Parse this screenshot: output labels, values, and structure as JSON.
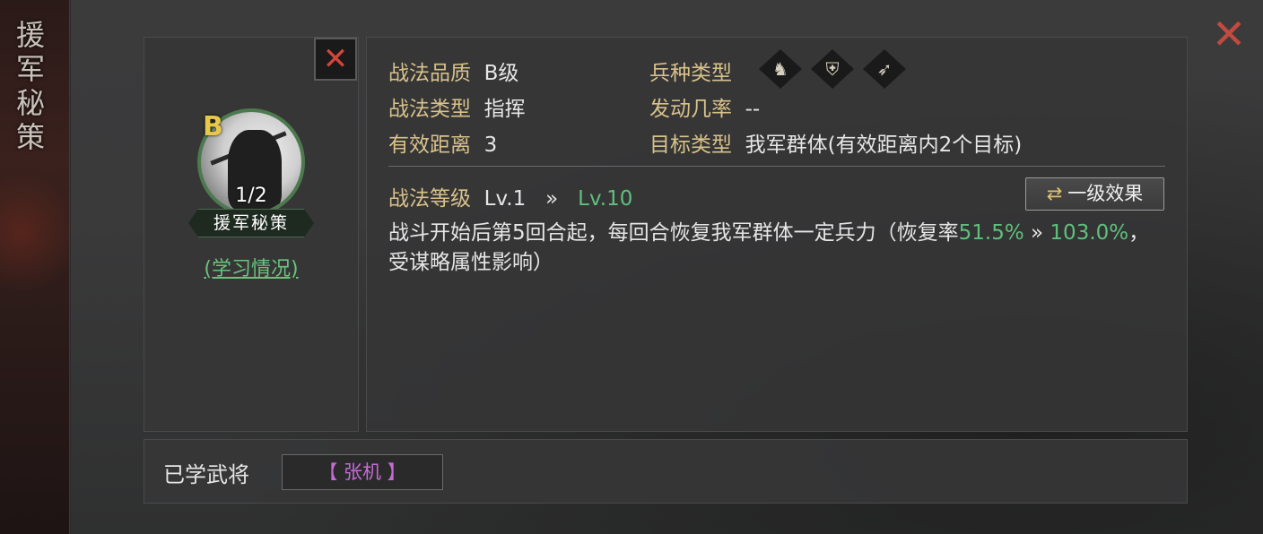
{
  "left_title": "援军秘策",
  "skill": {
    "grade": "B",
    "progress": "1/2",
    "name": "援军秘策",
    "learn_link": "(学习情况)"
  },
  "info": {
    "quality_label": "战法品质",
    "quality_value": "B级",
    "type_label": "战法类型",
    "type_value": "指挥",
    "range_label": "有效距离",
    "range_value": "3",
    "troop_label": "兵种类型",
    "rate_label": "发动几率",
    "rate_value": "--",
    "target_label": "目标类型",
    "target_value": "我军群体(有效距离内2个目标)",
    "troop_icons": [
      "cavalry-icon",
      "shield-icon",
      "bow-icon"
    ]
  },
  "level": {
    "label": "战法等级",
    "current": "Lv.1",
    "arrow": "»",
    "max": "Lv.10"
  },
  "effect_button": "一级效果",
  "description": {
    "part1": "战斗开始后第5回合起，每回合恢复我军群体一定兵力（恢复率",
    "rate_low": "51.5%",
    "arrow": " » ",
    "rate_high": "103.0%",
    "part2": "，受谋略属性影响）"
  },
  "learned": {
    "label": "已学武将",
    "general": "【 张机 】"
  },
  "colors": {
    "label_gold": "#d8c28a",
    "value_green": "#5fc07c",
    "close_red": "#c24a40",
    "general_purple": "#c46cd4"
  }
}
